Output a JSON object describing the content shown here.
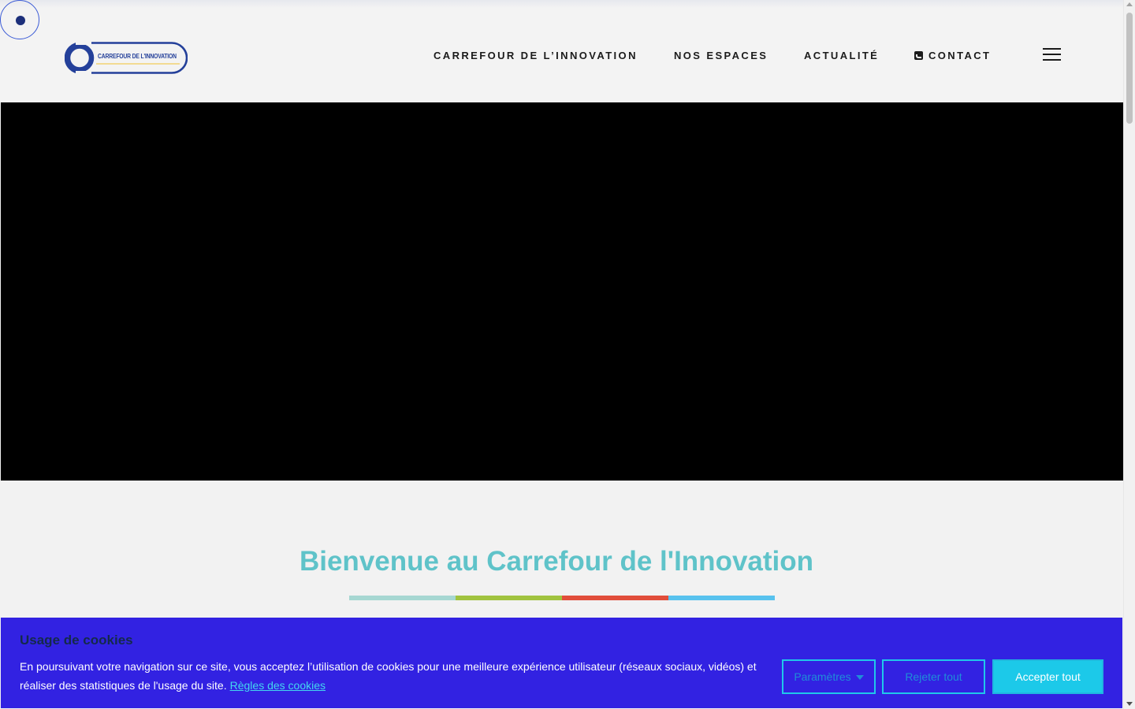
{
  "logo": {
    "text": "CARREFOUR DE L'INNOVATION"
  },
  "nav": {
    "items": [
      {
        "label": "CARREFOUR DE L’INNOVATION"
      },
      {
        "label": "NOS ESPACES"
      },
      {
        "label": "ACTUALITÉ"
      },
      {
        "label": "CONTACT",
        "icon": "phone-square-icon"
      }
    ],
    "menu_icon": "hamburger-menu-icon"
  },
  "welcome": {
    "title": "Bienvenue au Carrefour de l'Innovation",
    "bar_colors": [
      "#a6d7d2",
      "#a1c33f",
      "#e14e3b",
      "#58c2ee"
    ]
  },
  "cookie_banner": {
    "title": "Usage de cookies",
    "text": "En poursuivant votre navigation sur ce site, vous acceptez l’utilisation de cookies pour une meilleure expérience utilisateur (réseaux sociaux, vidéos) et réaliser des statistiques de l'usage du site.",
    "link_label": "Règles des cookies",
    "buttons": {
      "params": "Paramètres",
      "reject": "Rejeter tout",
      "accept": "Accepter tout"
    }
  },
  "colors": {
    "brand_blue": "#24409a",
    "accent_teal": "#5fc3c9",
    "banner_bg": "#3222e2",
    "button_cyan": "#1cc9e9"
  }
}
